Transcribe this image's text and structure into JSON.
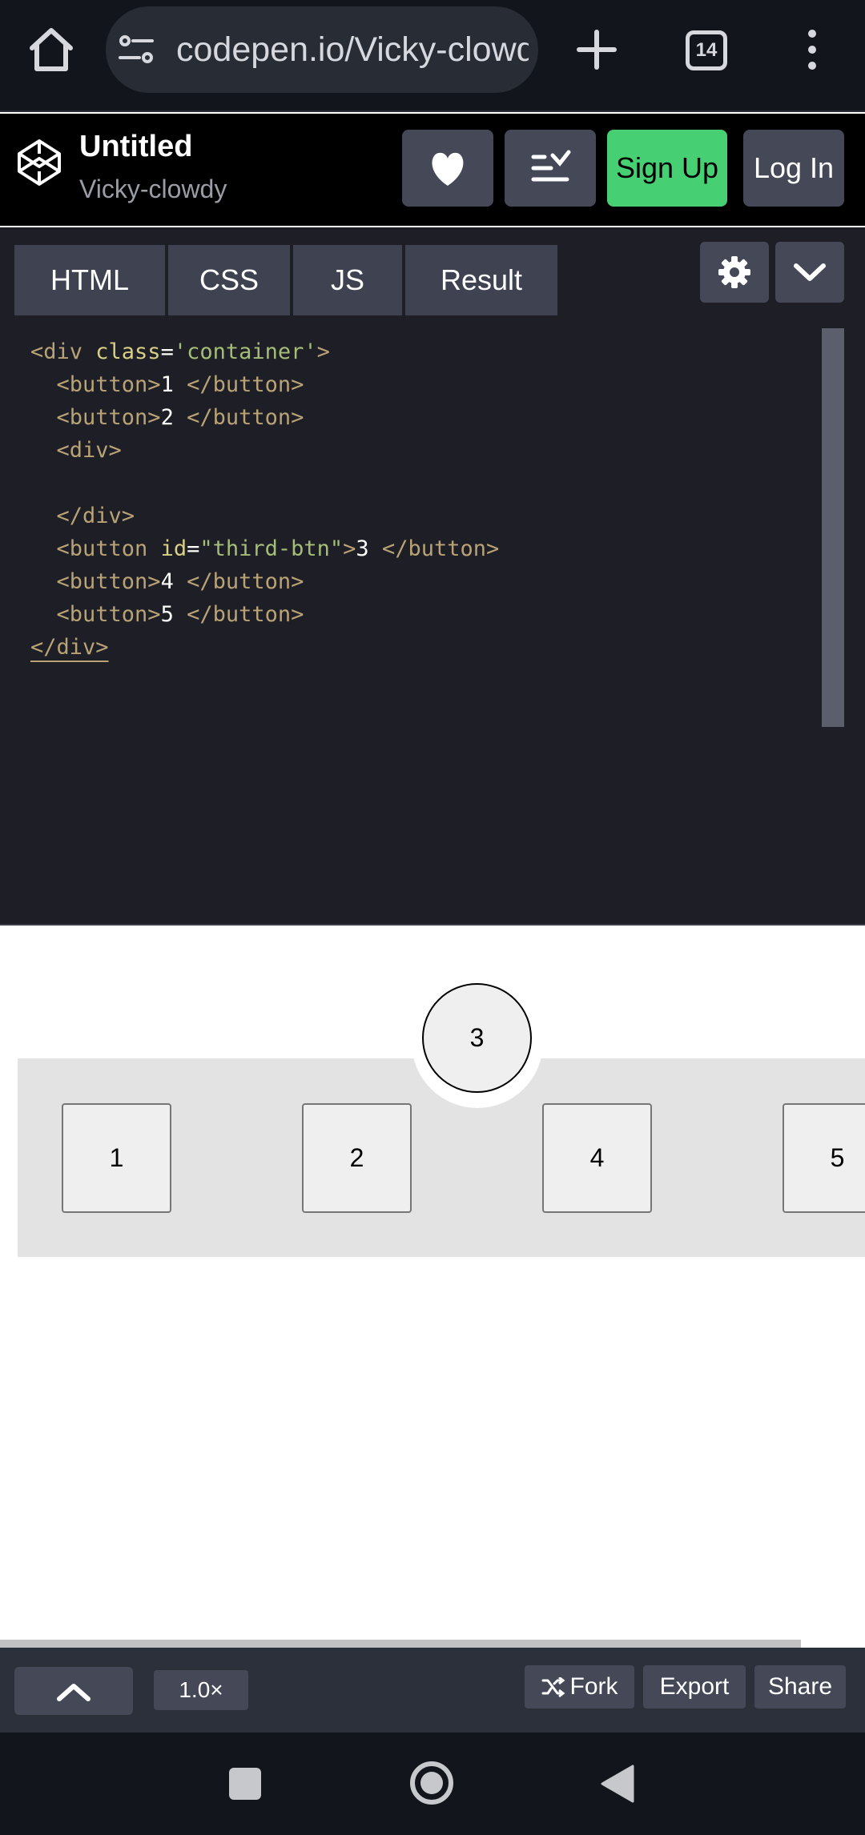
{
  "browser": {
    "url": "codepen.io/Vicky-clowdy",
    "tab_count": "14"
  },
  "header": {
    "title": "Untitled",
    "author": "Vicky-clowdy",
    "signup_label": "Sign Up",
    "login_label": "Log In"
  },
  "tabs": [
    {
      "label": "HTML"
    },
    {
      "label": "CSS"
    },
    {
      "label": "JS"
    },
    {
      "label": "Result"
    }
  ],
  "code": {
    "lines": [
      {
        "tag_open": "<div ",
        "attr": "class",
        "eq": "=",
        "val": "'container'",
        "close": ">",
        "text": "",
        "end": ""
      },
      {
        "tag_open": "  <button>",
        "text": "1",
        "end": " </button>"
      },
      {
        "tag_open": "  <button>",
        "text": "2",
        "end": " </button>"
      },
      {
        "tag_open": "  <div>"
      },
      {
        "tag_open": ""
      },
      {
        "tag_open": "  </div>"
      },
      {
        "tag_open": "  <button ",
        "attr": "id",
        "eq": "=",
        "val": "\"third-btn\"",
        "close": ">",
        "text": "3",
        "end": " </button>"
      },
      {
        "tag_open": "  <button>",
        "text": "4",
        "end": " </button>"
      },
      {
        "tag_open": "  <button>",
        "text": "5",
        "end": " </button>"
      },
      {
        "tag_open": "</div>"
      }
    ]
  },
  "result": {
    "buttons": [
      "1",
      "2",
      "3",
      "4",
      "5"
    ]
  },
  "footer": {
    "zoom": "1.0×",
    "fork_label": "Fork",
    "export_label": "Export",
    "share_label": "Share"
  }
}
